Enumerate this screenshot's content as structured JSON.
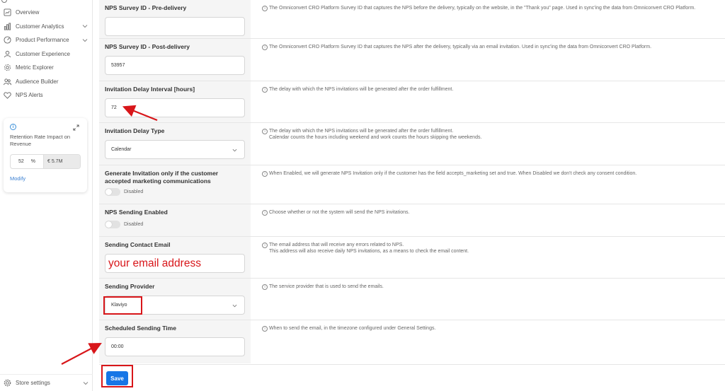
{
  "sidebar": {
    "items": [
      {
        "label": "Overview",
        "icon": "overview-icon",
        "chevron": false
      },
      {
        "label": "Customer Analytics",
        "icon": "analytics-icon",
        "chevron": true
      },
      {
        "label": "Product Performance",
        "icon": "product-icon",
        "chevron": true
      },
      {
        "label": "Customer Experience",
        "icon": "experience-icon",
        "chevron": false
      },
      {
        "label": "Metric Explorer",
        "icon": "metric-icon",
        "chevron": false
      },
      {
        "label": "Audience Builder",
        "icon": "audience-icon",
        "chevron": false
      },
      {
        "label": "NPS Alerts",
        "icon": "alert-icon",
        "chevron": false
      }
    ],
    "widget": {
      "title": "Retention Rate Impact on Revenue",
      "rate_value": "52",
      "rate_unit": "%",
      "revenue": "€ 5.7M",
      "modify": "Modify"
    },
    "store_settings": "Store settings"
  },
  "form": {
    "pre_delivery": {
      "label": "NPS Survey ID - Pre-delivery",
      "value": "",
      "desc": "The Omniconvert CRO Platform Survey ID that captures the NPS before the delivery, typically on the website, in the \"Thank you\" page. Used in sync'ing the data from Omniconvert CRO Platform."
    },
    "post_delivery": {
      "label": "NPS Survey ID - Post-delivery",
      "value": "53957",
      "desc": "The Omniconvert CRO Platform Survey ID that captures the NPS after the delivery, typically via an email invitation. Used in sync'ing the data from Omniconvert CRO Platform."
    },
    "delay_interval": {
      "label": "Invitation Delay Interval [hours]",
      "value": "72",
      "desc": "The delay with which the NPS invitations will be generated after the order fulfillment."
    },
    "delay_type": {
      "label": "Invitation Delay Type",
      "value": "Calendar",
      "desc": "The delay with which the NPS invitations will be generated after the order fulfillment.\nCalendar counts the hours including weekend and work counts the hours skipping the weekends."
    },
    "generate_invitation": {
      "label": "Generate Invitation only if the customer accepted marketing communications",
      "toggle": "Disabled",
      "desc": "When Enabled, we will generate NPS Invitation only if the customer has the field accepts_marketing set and true. When Disabled we don't check any consent condition."
    },
    "sending_enabled": {
      "label": "NPS Sending Enabled",
      "toggle": "Disabled",
      "desc": "Choose whether or not the system will send the NPS invitations."
    },
    "contact_email": {
      "label": "Sending Contact Email",
      "value": "your email address",
      "desc": "The email address that will receive any errors related to NPS.\nThis address will also receive daily NPS invitations, as a means to check the email content."
    },
    "provider": {
      "label": "Sending Provider",
      "value": "Klaviyo",
      "desc": "The service provider that is used to send the emails."
    },
    "sending_time": {
      "label": "Scheduled Sending Time",
      "value": "00:00",
      "desc": "When to send the email, in the timezone configured under General Settings."
    }
  },
  "footer": {
    "save": "Save"
  },
  "colors": {
    "accent": "#1776e6",
    "annotation": "#d8161a"
  }
}
